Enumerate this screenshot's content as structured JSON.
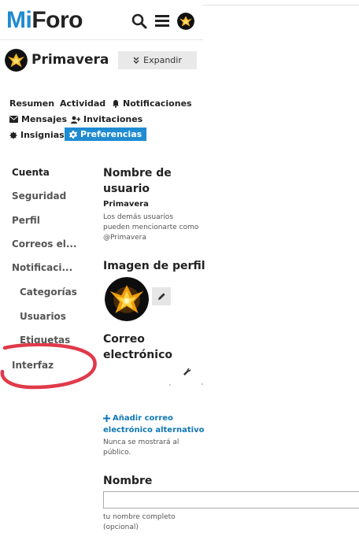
{
  "header": {
    "logo_prefix": "Mi",
    "logo_suffix": "Foro",
    "icons": [
      "search-icon",
      "hamburger-menu-icon",
      "user-avatar"
    ]
  },
  "user": {
    "name": "Primavera",
    "expand_label": "Expandir"
  },
  "nav": {
    "resumen": "Resumen",
    "actividad": "Actividad",
    "notificaciones": "Notificaciones",
    "mensajes": "Mensajes",
    "invitaciones": "Invitaciones",
    "insignias": "Insignias",
    "preferencias": "Preferencias"
  },
  "sidebar": {
    "items": [
      {
        "label": "Cuenta"
      },
      {
        "label": "Seguridad"
      },
      {
        "label": "Perfil"
      },
      {
        "label": "Correos el..."
      },
      {
        "label": "Notificaci..."
      },
      {
        "label": "Categorías"
      },
      {
        "label": "Usuarios"
      },
      {
        "label": "Etiquetas"
      },
      {
        "label": "Interfaz"
      }
    ]
  },
  "main": {
    "username_heading_1": "Nombre de",
    "username_heading_2": "usuario",
    "username_value": "Primavera",
    "mention_1": "Los demás usuarios",
    "mention_2": "pueden mencionarte como",
    "mention_3": "@Primavera",
    "profile_image_heading": "Imagen de perfil",
    "email_heading_1": "Correo",
    "email_heading_2": "electrónico",
    "add_email_1": "Añadir correo",
    "add_email_2": "electrónico alternativo",
    "never_shown_1": "Nunca se mostrará al",
    "never_shown_2": "público.",
    "name_heading": "Nombre",
    "name_hint_1": "tu nombre completo",
    "name_hint_2": "(opcional)"
  },
  "colors": {
    "accent": "#1f8bd1",
    "link": "#1077b5",
    "highlight_circle": "#e03a4a"
  }
}
